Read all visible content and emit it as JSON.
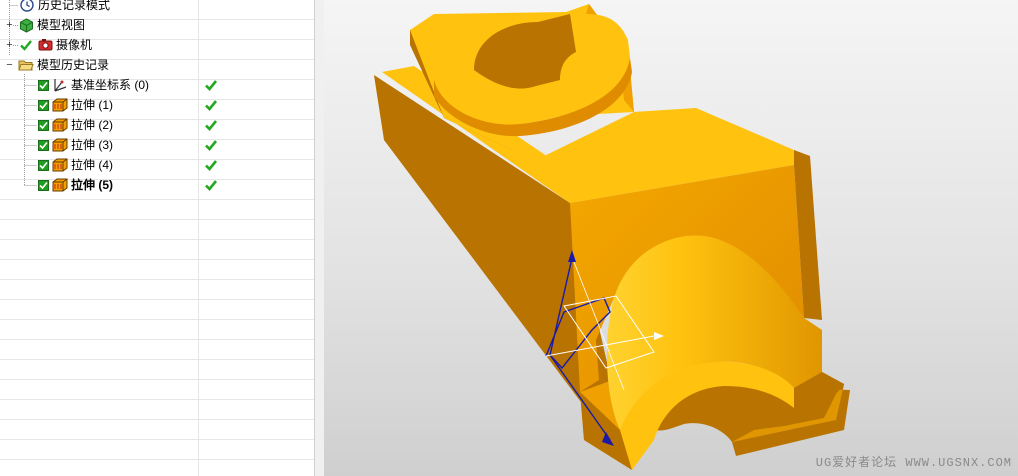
{
  "navigator": {
    "items": [
      {
        "label": "历史记录模式"
      },
      {
        "label": "模型视图"
      },
      {
        "label": "摄像机"
      },
      {
        "label": "模型历史记录"
      },
      {
        "label": "基准坐标系 (0)"
      },
      {
        "label": "拉伸 (1)"
      },
      {
        "label": "拉伸 (2)"
      },
      {
        "label": "拉伸 (3)"
      },
      {
        "label": "拉伸 (4)"
      },
      {
        "label": "拉伸 (5)"
      }
    ]
  },
  "colors": {
    "part_light": "#ffc20e",
    "part_mid": "#f0a000",
    "part_dark": "#b87300",
    "check_green": "#22a822",
    "sketch_blue": "#1a1aa6"
  },
  "icons": [
    "clock-icon",
    "model-views-icon",
    "camera-icon",
    "folder-open-icon",
    "datum-csys-icon",
    "extrude-icon",
    "check-icon"
  ],
  "watermark": "UG爱好者论坛 WWW.UGSNX.COM"
}
